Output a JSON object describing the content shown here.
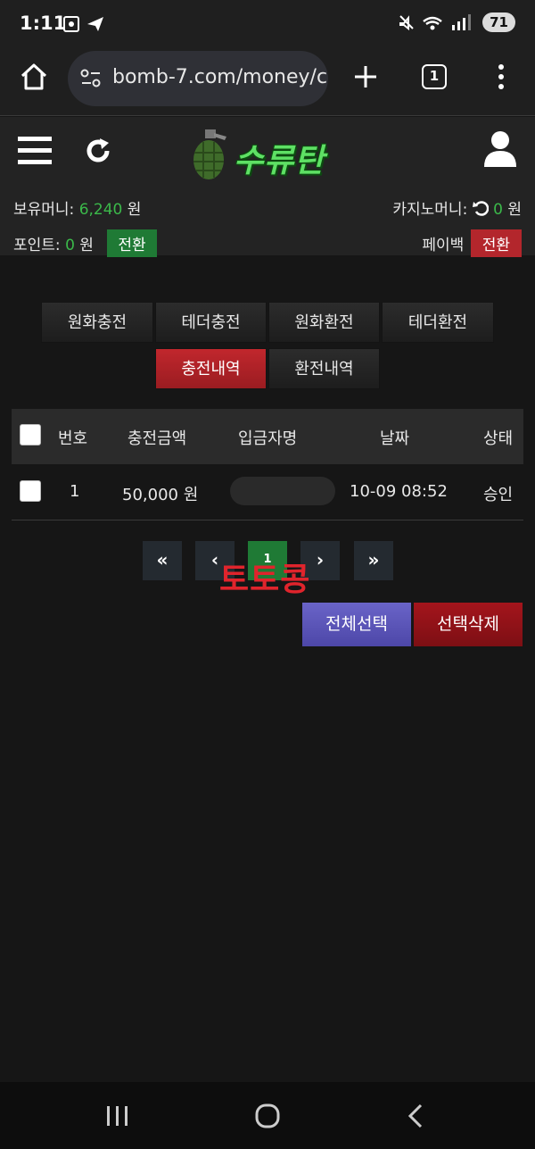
{
  "status_bar": {
    "time": "1:11",
    "battery": "71"
  },
  "browser": {
    "url": "bomb-7.com/money/c",
    "tab_count": "1"
  },
  "site": {
    "logo_text": "수류탄",
    "money_label": "보유머니:",
    "money_value": "6,240",
    "money_unit": "원",
    "casino_label": "카지노머니:",
    "casino_value": "0",
    "casino_unit": "원",
    "point_label": "포인트:",
    "point_value": "0",
    "point_unit": "원",
    "point_convert_button": "전환",
    "payback_label": "페이백",
    "payback_convert_button": "전환"
  },
  "tabs": [
    {
      "label": "원화충전",
      "active": false
    },
    {
      "label": "테더충전",
      "active": false
    },
    {
      "label": "원화환전",
      "active": false
    },
    {
      "label": "테더환전",
      "active": false
    },
    {
      "label": "충전내역",
      "active": true
    },
    {
      "label": "환전내역",
      "active": false
    }
  ],
  "table": {
    "headers": [
      "번호",
      "충전금액",
      "입금자명",
      "날짜",
      "상태"
    ],
    "rows": [
      {
        "no": "1",
        "amount": "50,000 원",
        "name": "",
        "date": "10-09 08:52",
        "status": "승인"
      }
    ]
  },
  "pagination": {
    "first": "«",
    "prev": "‹",
    "current": "1",
    "next": "›",
    "last": "»"
  },
  "watermark": "토토콩",
  "actions": {
    "select_all": "전체선택",
    "delete_selected": "선택삭제"
  },
  "colors": {
    "accent_green": "#3bb94a",
    "accent_red": "#b3262c",
    "select_all_purple": "#5a54b8"
  }
}
